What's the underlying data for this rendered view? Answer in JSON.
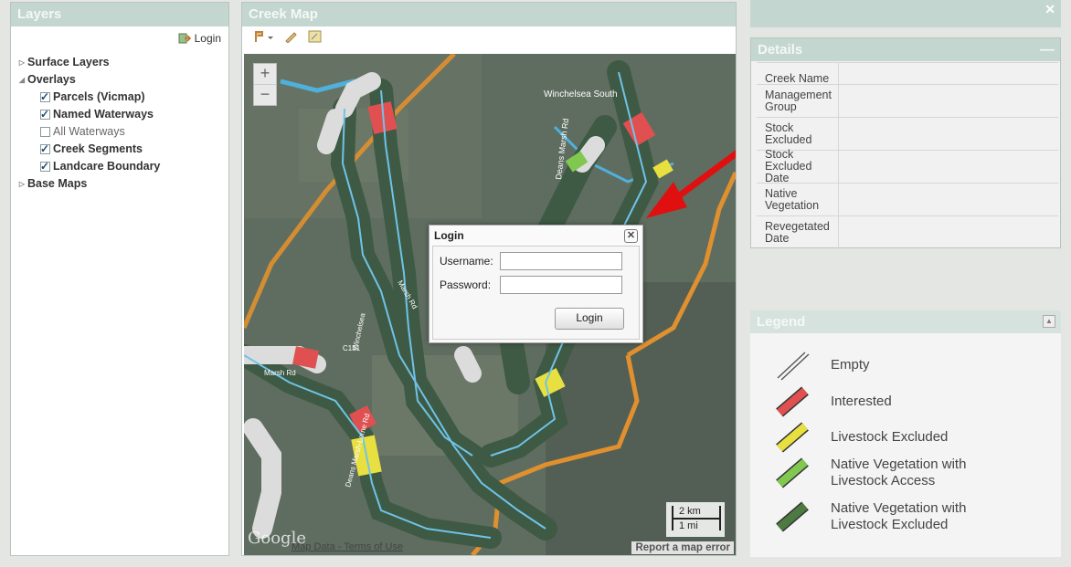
{
  "layers": {
    "title": "Layers",
    "login_label": "Login",
    "tree": {
      "surface": "Surface Layers",
      "overlays": "Overlays",
      "parcels": "Parcels (Vicmap)",
      "named": "Named Waterways",
      "all": "All Waterways",
      "segments": "Creek Segments",
      "landcare": "Landcare Boundary",
      "base": "Base Maps"
    }
  },
  "map": {
    "title": "Creek Map",
    "zoom_in": "+",
    "zoom_out": "−",
    "scale_km": "2 km",
    "scale_mi": "1 mi",
    "report": "Report a map error",
    "map_data": "Map Data",
    "terms": "Terms of Use",
    "google": "Google",
    "labels": {
      "winchelsea_south": "Winchelsea South",
      "deans_marsh_rd": "Deans Marsh Rd",
      "winchelsea": "Winchelsea",
      "c151": "C151",
      "marsh_rd": "Marsh Rd",
      "marsh_rd_2": "Marsh Rd",
      "deans_marsh_lorne": "Deans Marsh-Lorne Rd"
    }
  },
  "login": {
    "title": "Login",
    "close": "✕",
    "username_label": "Username:",
    "password_label": "Password:",
    "username_value": "",
    "password_value": "",
    "button": "Login"
  },
  "details": {
    "title": "Details",
    "fields": [
      "Creek Name",
      "Management Group",
      "Stock Excluded",
      "Stock Excluded Date",
      "Native Vegetation",
      "Revegetated Date"
    ]
  },
  "legend": {
    "title": "Legend",
    "items": [
      {
        "label": "Empty",
        "color": "#ffffff"
      },
      {
        "label": "Interested",
        "color": "#e05050"
      },
      {
        "label": "Livestock Excluded",
        "color": "#e8e040"
      },
      {
        "label": "Native Vegetation with Livestock Access",
        "color": "#80c850"
      },
      {
        "label": "Native Vegetation with Livestock Excluded",
        "color": "#4c7a40"
      }
    ]
  },
  "colors": {
    "accent": "#c3d6cf",
    "water": "#4fb0dc",
    "road": "#e0902e",
    "arrow": "#e01010"
  }
}
